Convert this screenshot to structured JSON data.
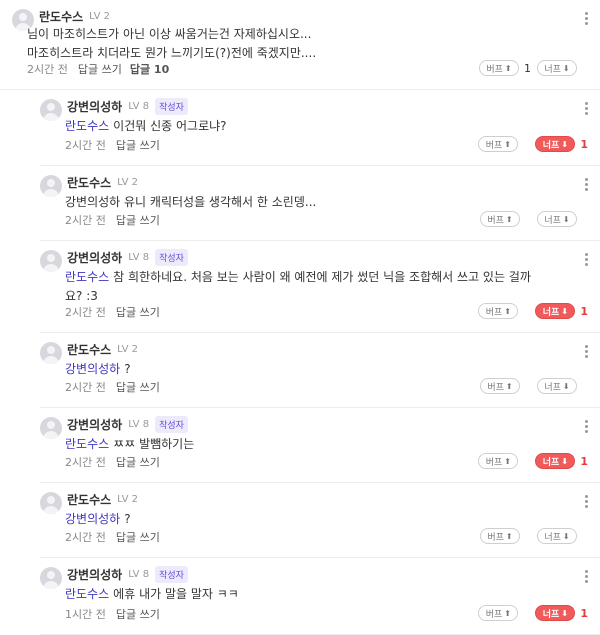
{
  "labels": {
    "reply": "답글 쓰기",
    "upvote": "버프",
    "downvote": "너프"
  },
  "colors": {
    "mention": "#3d34c4",
    "downvote_active": "#f05a5a",
    "author_badge": "#6a4bd8"
  },
  "icons": {
    "avatar": "default-avatar-icon",
    "more": "kebab-menu-icon",
    "up": "arrow-up-icon",
    "down": "arrow-down-icon"
  },
  "comments": [
    {
      "nick": "란도수스",
      "level": "LV 2",
      "badge": "",
      "mention": "",
      "lines": [
        "님이 마조히스트가 아닌 이상 싸움거는건 자제하십시오...",
        "마조히스트라 치더라도 뭔가 느끼기도(?)전에 죽겠지만...."
      ],
      "time": "2시간 전",
      "reply_count": "답글 10",
      "up_count": "1",
      "down_count": "",
      "down_active": false
    },
    {
      "nick": "강변의성하",
      "level": "LV 8",
      "badge": "작성자",
      "mention": "란도수스",
      "lines": [
        "이건뭐 신종 어그로냐?"
      ],
      "time": "2시간 전",
      "reply_count": "",
      "up_count": "",
      "down_count": "1",
      "down_active": true
    },
    {
      "nick": "란도수스",
      "level": "LV 2",
      "badge": "",
      "mention": "",
      "lines": [
        "강변의성하 유니 캐릭터성을 생각해서 한 소린뎅..."
      ],
      "time": "2시간 전",
      "reply_count": "",
      "up_count": "",
      "down_count": "",
      "down_active": false
    },
    {
      "nick": "강변의성하",
      "level": "LV 8",
      "badge": "작성자",
      "mention": "란도수스",
      "lines": [
        "참 희한하네요. 처음 보는 사람이 왜 예전에 제가 썼던 닉을 조합해서 쓰고 있는 걸까",
        "요? :3"
      ],
      "time": "2시간 전",
      "reply_count": "",
      "up_count": "",
      "down_count": "1",
      "down_active": true
    },
    {
      "nick": "란도수스",
      "level": "LV 2",
      "badge": "",
      "mention": "강변의성하",
      "lines": [
        "?"
      ],
      "time": "2시간 전",
      "reply_count": "",
      "up_count": "",
      "down_count": "",
      "down_active": false
    },
    {
      "nick": "강변의성하",
      "level": "LV 8",
      "badge": "작성자",
      "mention": "란도수스",
      "lines": [
        "ㅉㅉ 발뺌하기는"
      ],
      "time": "2시간 전",
      "reply_count": "",
      "up_count": "",
      "down_count": "1",
      "down_active": true
    },
    {
      "nick": "란도수스",
      "level": "LV 2",
      "badge": "",
      "mention": "강변의성하",
      "lines": [
        "?"
      ],
      "time": "2시간 전",
      "reply_count": "",
      "up_count": "",
      "down_count": "",
      "down_active": false
    },
    {
      "nick": "강변의성하",
      "level": "LV 8",
      "badge": "작성자",
      "mention": "란도수스",
      "lines": [
        "에휴 내가 말을 말자 ㅋㅋ"
      ],
      "time": "1시간 전",
      "reply_count": "",
      "up_count": "",
      "down_count": "1",
      "down_active": true
    }
  ]
}
